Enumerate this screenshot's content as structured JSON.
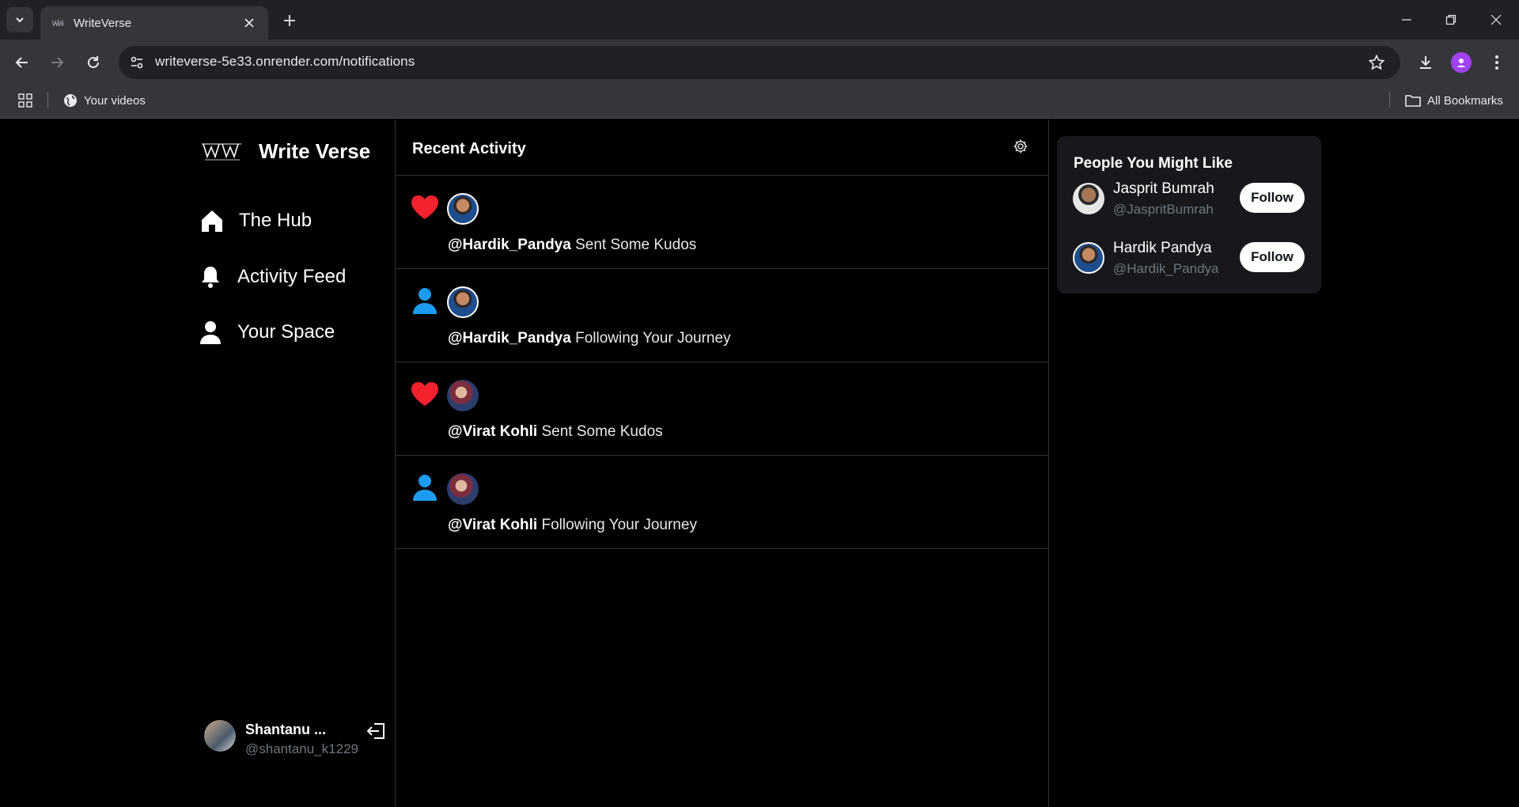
{
  "browser": {
    "tab_title": "WriteVerse",
    "url": "writeverse-5e33.onrender.com/notifications",
    "bookmarks": [
      {
        "label": "Your videos",
        "icon": "globe-icon"
      }
    ],
    "all_bookmarks_label": "All Bookmarks"
  },
  "sidebar": {
    "brand": "Write Verse",
    "nav": [
      {
        "label": "The Hub",
        "icon": "home-icon"
      },
      {
        "label": "Activity Feed",
        "icon": "bell-icon"
      },
      {
        "label": "Your Space",
        "icon": "user-icon"
      }
    ],
    "user": {
      "name": "Shantanu ...",
      "handle": "@shantanu_k1229"
    }
  },
  "feed": {
    "title": "Recent Activity",
    "notifications": [
      {
        "type": "like",
        "type_icon": "heart-icon",
        "user": "@Hardik_Pandya",
        "text": "Sent Some Kudos"
      },
      {
        "type": "follow",
        "type_icon": "person-icon",
        "user": "@Hardik_Pandya",
        "text": "Following Your Journey"
      },
      {
        "type": "like",
        "type_icon": "heart-icon",
        "user": "@Virat Kohli",
        "text": "Sent Some Kudos"
      },
      {
        "type": "follow",
        "type_icon": "person-icon",
        "user": "@Virat Kohli",
        "text": "Following Your Journey"
      }
    ]
  },
  "suggestions": {
    "title": "People You Might Like",
    "people": [
      {
        "name": "Jasprit Bumrah",
        "handle": "@JaspritBumrah",
        "button": "Follow"
      },
      {
        "name": "Hardik Pandya",
        "handle": "@Hardik_Pandya",
        "button": "Follow"
      }
    ]
  },
  "colors": {
    "like": "#f4212e",
    "follow": "#1d9bf0",
    "muted_text": "#6e767d",
    "background": "#000000"
  }
}
